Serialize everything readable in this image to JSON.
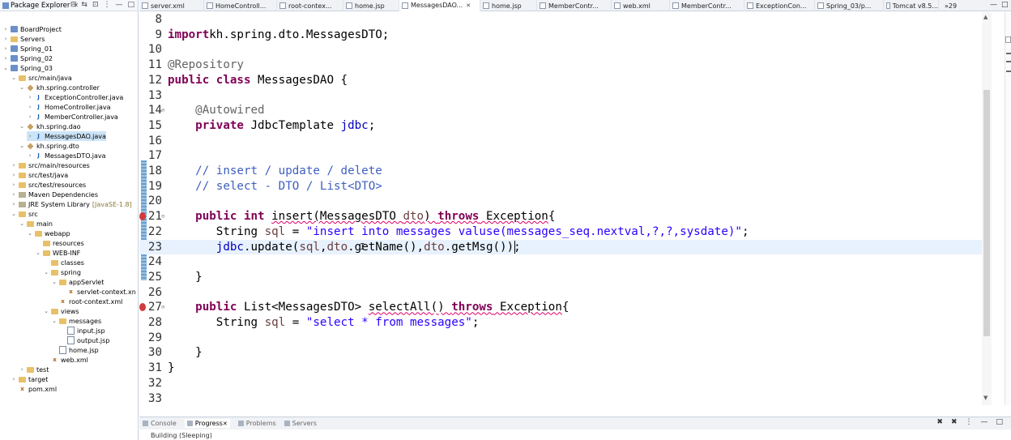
{
  "explorer": {
    "title": "Package Explorer",
    "tree": [
      {
        "label": "BoardProject",
        "indent": 0,
        "arrow": "›",
        "icon": "proj"
      },
      {
        "label": "Servers",
        "indent": 0,
        "arrow": "›",
        "icon": "folder"
      },
      {
        "label": "Spring_01",
        "indent": 0,
        "arrow": "›",
        "icon": "proj"
      },
      {
        "label": "Spring_02",
        "indent": 0,
        "arrow": "›",
        "icon": "proj"
      },
      {
        "label": "Spring_03",
        "indent": 0,
        "arrow": "⌄",
        "icon": "proj"
      },
      {
        "label": "src/main/java",
        "indent": 1,
        "arrow": "⌄",
        "icon": "folder"
      },
      {
        "label": "kh.spring.controller",
        "indent": 2,
        "arrow": "⌄",
        "icon": "pkg"
      },
      {
        "label": "ExceptionController.java",
        "indent": 3,
        "arrow": "›",
        "icon": "java"
      },
      {
        "label": "HomeController.java",
        "indent": 3,
        "arrow": "›",
        "icon": "java"
      },
      {
        "label": "MemberController.java",
        "indent": 3,
        "arrow": "›",
        "icon": "java"
      },
      {
        "label": "kh.spring.dao",
        "indent": 2,
        "arrow": "⌄",
        "icon": "pkg"
      },
      {
        "label": "MessagesDAO.java",
        "indent": 3,
        "arrow": "›",
        "icon": "java",
        "selected": true
      },
      {
        "label": "kh.spring.dto",
        "indent": 2,
        "arrow": "⌄",
        "icon": "pkg"
      },
      {
        "label": "MessagesDTO.java",
        "indent": 3,
        "arrow": "›",
        "icon": "java"
      },
      {
        "label": "src/main/resources",
        "indent": 1,
        "arrow": "›",
        "icon": "folder"
      },
      {
        "label": "src/test/java",
        "indent": 1,
        "arrow": "›",
        "icon": "folder"
      },
      {
        "label": "src/test/resources",
        "indent": 1,
        "arrow": "›",
        "icon": "folder"
      },
      {
        "label": "Maven Dependencies",
        "indent": 1,
        "arrow": "›",
        "icon": "lib"
      },
      {
        "label": "JRE System Library",
        "extra": "[JavaSE-1.8]",
        "indent": 1,
        "arrow": "›",
        "icon": "lib"
      },
      {
        "label": "src",
        "indent": 1,
        "arrow": "⌄",
        "icon": "folder"
      },
      {
        "label": "main",
        "indent": 2,
        "arrow": "⌄",
        "icon": "folder"
      },
      {
        "label": "webapp",
        "indent": 3,
        "arrow": "⌄",
        "icon": "folder"
      },
      {
        "label": "resources",
        "indent": 4,
        "arrow": "",
        "icon": "folder"
      },
      {
        "label": "WEB-INF",
        "indent": 4,
        "arrow": "⌄",
        "icon": "folder"
      },
      {
        "label": "classes",
        "indent": 5,
        "arrow": "",
        "icon": "folder"
      },
      {
        "label": "spring",
        "indent": 5,
        "arrow": "⌄",
        "icon": "folder"
      },
      {
        "label": "appServlet",
        "indent": 6,
        "arrow": "⌄",
        "icon": "folder"
      },
      {
        "label": "servlet-context.xn",
        "indent": 7,
        "arrow": "",
        "icon": "xml"
      },
      {
        "label": "root-context.xml",
        "indent": 6,
        "arrow": "",
        "icon": "xml"
      },
      {
        "label": "views",
        "indent": 5,
        "arrow": "⌄",
        "icon": "folder"
      },
      {
        "label": "messages",
        "indent": 6,
        "arrow": "⌄",
        "icon": "folder"
      },
      {
        "label": "input.jsp",
        "indent": 7,
        "arrow": "",
        "icon": "jsp"
      },
      {
        "label": "output.jsp",
        "indent": 7,
        "arrow": "",
        "icon": "jsp"
      },
      {
        "label": "home.jsp",
        "indent": 6,
        "arrow": "",
        "icon": "jsp"
      },
      {
        "label": "web.xml",
        "indent": 5,
        "arrow": "",
        "icon": "xml"
      },
      {
        "label": "test",
        "indent": 2,
        "arrow": "›",
        "icon": "folder"
      },
      {
        "label": "target",
        "indent": 1,
        "arrow": "›",
        "icon": "folder"
      },
      {
        "label": "pom.xml",
        "indent": 1,
        "arrow": "",
        "icon": "xml"
      }
    ]
  },
  "tabs": [
    {
      "label": "server.xml",
      "active": false
    },
    {
      "label": "HomeControll...",
      "active": false
    },
    {
      "label": "root-contex...",
      "active": false
    },
    {
      "label": "home.jsp",
      "active": false
    },
    {
      "label": "MessagesDAO...",
      "active": true
    },
    {
      "label": "home.jsp",
      "active": false
    },
    {
      "label": "MemberContr...",
      "active": false
    },
    {
      "label": "web.xml",
      "active": false
    },
    {
      "label": "MemberContr...",
      "active": false
    },
    {
      "label": "ExceptionCon...",
      "active": false
    },
    {
      "label": "Spring_03/p...",
      "active": false
    },
    {
      "label": "Tomcat v8.5...",
      "active": false
    }
  ],
  "tab_overflow": "»29",
  "code": [
    {
      "n": "8",
      "tokens": []
    },
    {
      "n": "9",
      "tokens": [
        [
          "kw",
          "import"
        ],
        [
          "",
          "kh.spring.dto.MessagesDTO;"
        ]
      ]
    },
    {
      "n": "10",
      "tokens": []
    },
    {
      "n": "11",
      "tokens": [
        [
          "ann",
          "@Repository"
        ]
      ]
    },
    {
      "n": "12",
      "tokens": [
        [
          "kw",
          "public"
        ],
        [
          "",
          " "
        ],
        [
          "kw",
          "class"
        ],
        [
          "",
          " MessagesDAO {"
        ]
      ]
    },
    {
      "n": "13",
      "tokens": []
    },
    {
      "n": "14",
      "fold": true,
      "tokens": [
        [
          "",
          " "
        ],
        [
          "ann",
          "@Autowired"
        ]
      ]
    },
    {
      "n": "15",
      "tokens": [
        [
          "",
          " "
        ],
        [
          "kw",
          "private"
        ],
        [
          "",
          " JdbcTemplate "
        ],
        [
          "fld",
          "jdbc"
        ],
        [
          "",
          ";"
        ]
      ]
    },
    {
      "n": "16",
      "tokens": []
    },
    {
      "n": "17",
      "tokens": []
    },
    {
      "n": "18",
      "tokens": [
        [
          "",
          " "
        ],
        [
          "cmt",
          "// insert / update / delete"
        ]
      ]
    },
    {
      "n": "19",
      "tokens": [
        [
          "",
          " "
        ],
        [
          "cmt",
          "// select - DTO / List<DTO>"
        ]
      ]
    },
    {
      "n": "20",
      "tokens": []
    },
    {
      "n": "21",
      "fold": true,
      "error": true,
      "tokens": [
        [
          "",
          " "
        ],
        [
          "kw",
          "public"
        ],
        [
          "",
          " "
        ],
        [
          "kw",
          "int"
        ],
        [
          "",
          " "
        ],
        [
          "squig",
          "insert(MessagesDTO "
        ],
        [
          "squigvar",
          "dto"
        ],
        [
          "squig",
          ") "
        ],
        [
          "squigkw",
          "throws"
        ],
        [
          "squig",
          " Exception"
        ],
        [
          "",
          "{"
        ]
      ]
    },
    {
      "n": "22",
      "tokens": [
        [
          "",
          " String "
        ],
        [
          "var",
          "sql"
        ],
        [
          "",
          " = "
        ],
        [
          "str",
          "\"insert into messages valuse(messages_seq.nextval,?,?,sysdate)\""
        ],
        [
          "",
          ";"
        ]
      ]
    },
    {
      "n": "23",
      "current": true,
      "tokens": [
        [
          "",
          " "
        ],
        [
          "fld",
          "jdbc"
        ],
        [
          "",
          ".update("
        ],
        [
          "var",
          "sql"
        ],
        [
          "",
          ","
        ],
        [
          "var",
          "dto"
        ],
        [
          "",
          ".getName(),"
        ],
        [
          "var",
          "dto"
        ],
        [
          "",
          ".getMsg());"
        ]
      ]
    },
    {
      "n": "24",
      "tokens": []
    },
    {
      "n": "25",
      "tokens": [
        [
          "",
          " }"
        ]
      ]
    },
    {
      "n": "26",
      "tokens": []
    },
    {
      "n": "27",
      "fold": true,
      "error": true,
      "tokens": [
        [
          "",
          " "
        ],
        [
          "kw",
          "public"
        ],
        [
          "",
          " List<MessagesDTO> "
        ],
        [
          "squig",
          "selectAll() "
        ],
        [
          "squigkw",
          "throws"
        ],
        [
          "squig",
          " Exception"
        ],
        [
          "",
          "{"
        ]
      ]
    },
    {
      "n": "28",
      "tokens": [
        [
          "",
          " String "
        ],
        [
          "var",
          "sql"
        ],
        [
          "",
          " = "
        ],
        [
          "str",
          "\"select * from messages\""
        ],
        [
          "",
          ";"
        ]
      ]
    },
    {
      "n": "29",
      "tokens": []
    },
    {
      "n": "30",
      "tokens": [
        [
          "",
          " }"
        ]
      ]
    },
    {
      "n": "31",
      "tokens": [
        [
          "",
          "}"
        ]
      ]
    },
    {
      "n": "32",
      "tokens": []
    },
    {
      "n": "33",
      "tokens": []
    }
  ],
  "bottom": {
    "tabs": [
      {
        "label": "Console",
        "active": false
      },
      {
        "label": "Progress",
        "active": true
      },
      {
        "label": "Problems",
        "active": false
      },
      {
        "label": "Servers",
        "active": false
      }
    ],
    "progress_text": "Building (Sleeping)"
  },
  "colors": {
    "keyword": "#7f0055",
    "string": "#2a00ff",
    "comment": "#3f5fbf",
    "field": "#0000c0",
    "annotation": "#646464",
    "current_line": "#e8f2fe"
  }
}
